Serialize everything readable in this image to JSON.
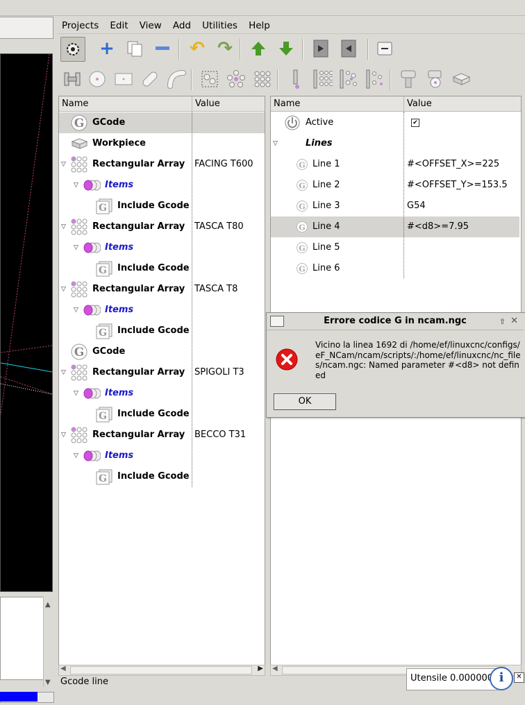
{
  "menubar": {
    "items": [
      "Projects",
      "Edit",
      "View",
      "Add",
      "Utilities",
      "Help"
    ]
  },
  "toolbar1": {
    "icons": [
      "settings-gear-icon",
      "add-plus-icon",
      "copy-icon",
      "remove-minus-icon",
      "undo-icon",
      "redo-icon",
      "move-up-icon",
      "move-down-icon",
      "indent-icon",
      "unindent-icon",
      "collapse-icon"
    ]
  },
  "toolbar2": {
    "icons": [
      "tool-holder-icon",
      "circle-icon",
      "rectangle-icon",
      "slot-icon",
      "arc-slot-icon",
      "selection-points-icon",
      "circular-array-icon",
      "rectangular-array-icon",
      "drill-icon",
      "grid-array-icon",
      "grid-array-alt-icon",
      "scatter-array-icon",
      "bolt-icon",
      "thread-icon",
      "workpiece-icon"
    ]
  },
  "left_tree": {
    "col_name": "Name",
    "col_value": "Value",
    "rows": [
      {
        "label": "GCode",
        "value": "",
        "type": "gcode",
        "level": 0,
        "expander": "",
        "selected": true
      },
      {
        "label": "Workpiece",
        "value": "",
        "type": "workpiece",
        "level": 0,
        "expander": ""
      },
      {
        "label": "Rectangular Array",
        "value": "FACING T600",
        "type": "array",
        "level": 0,
        "expander": "▽"
      },
      {
        "label": "Items",
        "value": "",
        "type": "items",
        "level": 1,
        "expander": "▽"
      },
      {
        "label": "Include Gcode",
        "value": "",
        "type": "include",
        "level": 2,
        "expander": ""
      },
      {
        "label": "Rectangular Array",
        "value": "TASCA T80",
        "type": "array",
        "level": 0,
        "expander": "▽"
      },
      {
        "label": "Items",
        "value": "",
        "type": "items",
        "level": 1,
        "expander": "▽"
      },
      {
        "label": "Include Gcode",
        "value": "",
        "type": "include",
        "level": 2,
        "expander": ""
      },
      {
        "label": "Rectangular Array",
        "value": "TASCA T8",
        "type": "array",
        "level": 0,
        "expander": "▽"
      },
      {
        "label": "Items",
        "value": "",
        "type": "items",
        "level": 1,
        "expander": "▽"
      },
      {
        "label": "Include Gcode",
        "value": "",
        "type": "include",
        "level": 2,
        "expander": ""
      },
      {
        "label": "GCode",
        "value": "",
        "type": "gcode",
        "level": 0,
        "expander": ""
      },
      {
        "label": "Rectangular Array",
        "value": "SPIGOLI T3",
        "type": "array",
        "level": 0,
        "expander": "▽"
      },
      {
        "label": "Items",
        "value": "",
        "type": "items",
        "level": 1,
        "expander": "▽"
      },
      {
        "label": "Include Gcode",
        "value": "",
        "type": "include",
        "level": 2,
        "expander": ""
      },
      {
        "label": "Rectangular Array",
        "value": "BECCO T31",
        "type": "array",
        "level": 0,
        "expander": "▽"
      },
      {
        "label": "Items",
        "value": "",
        "type": "items",
        "level": 1,
        "expander": "▽"
      },
      {
        "label": "Include Gcode",
        "value": "",
        "type": "include",
        "level": 2,
        "expander": ""
      }
    ]
  },
  "right_tree": {
    "col_name": "Name",
    "col_value": "Value",
    "rows": [
      {
        "label": "Active",
        "value": "",
        "type": "active",
        "checked": true
      },
      {
        "label": "Lines",
        "value": "",
        "type": "lines"
      },
      {
        "label": "Line 1",
        "value": "#<OFFSET_X>=225",
        "type": "line"
      },
      {
        "label": "Line 2",
        "value": "#<OFFSET_Y>=153.5",
        "type": "line"
      },
      {
        "label": "Line 3",
        "value": "G54",
        "type": "line"
      },
      {
        "label": "Line 4",
        "value": "#<d8>=7.95",
        "type": "line",
        "selected": true
      },
      {
        "label": "Line 5",
        "value": "",
        "type": "line"
      },
      {
        "label": "Line 6",
        "value": "",
        "type": "line"
      }
    ]
  },
  "dialog": {
    "title": "Errore codice G in ncam.ngc",
    "message": "Vicino la linea  1692 di /home/ef/linuxcnc/configs/eF_NCam/ncam/scripts/:/home/ef/linuxcnc/nc_files/ncam.ngc: Named parameter #<d8> not defined",
    "ok_label": "OK"
  },
  "status": {
    "left": "Gcode line",
    "tool": "Utensile 0.000000"
  },
  "colors": {
    "items_text": "#1a1ac8",
    "error_red": "#e01818",
    "progress": "#0000ff"
  }
}
